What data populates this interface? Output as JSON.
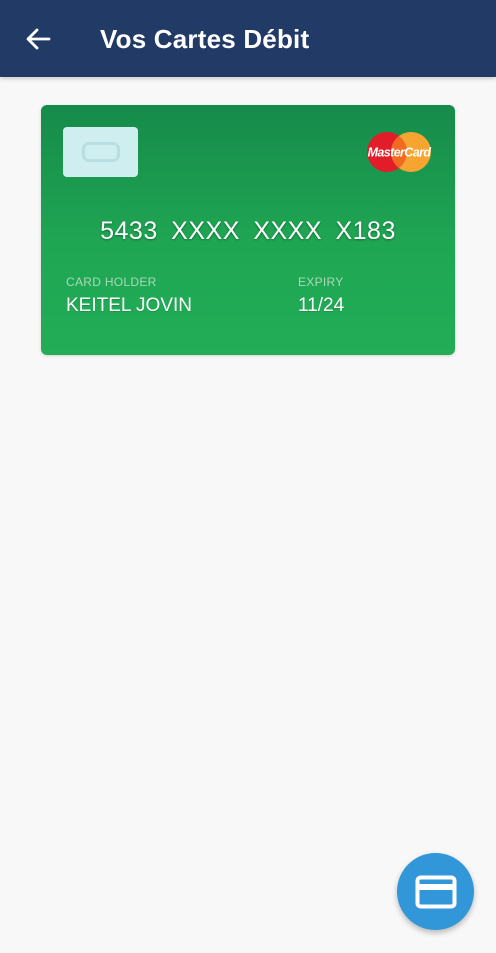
{
  "header": {
    "title": "Vos Cartes Débit",
    "back_icon": "arrow-left-icon",
    "background_color": "#213b66"
  },
  "card": {
    "number": "5433  XXXX  XXXX  X183",
    "holder_label": "CARD HOLDER",
    "holder_name": "KEITEL JOVIN",
    "expiry_label": "EXPIRY",
    "expiry_value": "11/24",
    "brand": "MasterCard",
    "brand_logo": "mastercard-logo",
    "chip_icon": "card-chip-icon",
    "color": "#1fa653"
  },
  "fab": {
    "icon": "credit-card-icon",
    "color": "#3297d8"
  }
}
